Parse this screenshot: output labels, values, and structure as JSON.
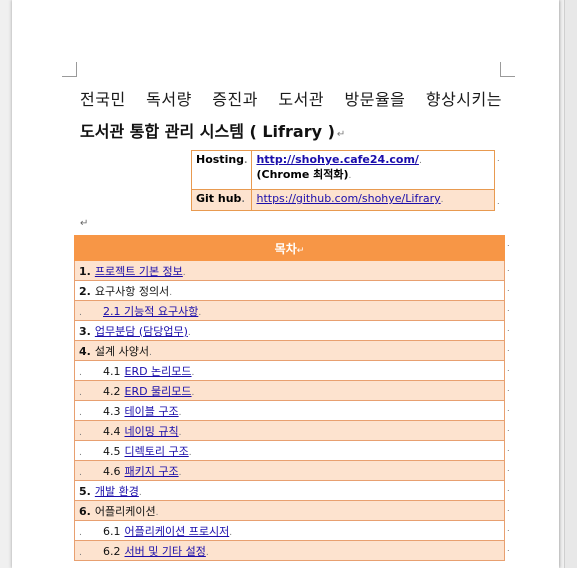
{
  "title": {
    "line1_words": [
      "전국민",
      "독서량",
      "증진과",
      "도서관",
      "방문율을",
      "향상시키는"
    ],
    "line2": "도서관 통합 관리 시스템 ( Lifrary )"
  },
  "info": [
    {
      "label": "Hosting",
      "link": "http://shohye.cafe24.com/",
      "note": "(Chrome 최적화)"
    },
    {
      "label": "Git hub",
      "link": "https://github.com/shohye/Lifrary"
    }
  ],
  "toc": {
    "heading": "목차",
    "items": [
      {
        "indent": 0,
        "num": "1.",
        "text": "프로젝트 기본 정보",
        "link": true,
        "shade": true
      },
      {
        "indent": 0,
        "num": "2.",
        "text": "요구사항 정의서",
        "link": false,
        "shade": false
      },
      {
        "indent": 1,
        "num": "",
        "text": "2.1 기능적 요구사항",
        "link": true,
        "shade": true
      },
      {
        "indent": 0,
        "num": "3.",
        "text": "업무분담 (담당업무)",
        "link": true,
        "shade": false
      },
      {
        "indent": 0,
        "num": "4.",
        "text": "설계 사양서",
        "link": false,
        "shade": true
      },
      {
        "indent": 1,
        "num": "4.1",
        "text": "ERD 논리모드",
        "link": true,
        "shade": false
      },
      {
        "indent": 1,
        "num": "4.2",
        "text": "ERD 물리모드",
        "link": true,
        "shade": true
      },
      {
        "indent": 1,
        "num": "4.3",
        "text": "테이블 구조",
        "link": true,
        "shade": false
      },
      {
        "indent": 1,
        "num": "4.4",
        "text": "네이밍 규칙",
        "link": true,
        "shade": true
      },
      {
        "indent": 1,
        "num": "4.5",
        "text": "디렉토리 구조",
        "link": true,
        "shade": false
      },
      {
        "indent": 1,
        "num": "4.6",
        "text": "패키지 구조",
        "link": true,
        "shade": true
      },
      {
        "indent": 0,
        "num": "5.",
        "text": "개발 환경",
        "link": true,
        "shade": false
      },
      {
        "indent": 0,
        "num": "6.",
        "text": "어플리케이션",
        "link": false,
        "shade": true
      },
      {
        "indent": 1,
        "num": "6.1",
        "text": "어플리케이션 프로시저",
        "link": true,
        "shade": false
      },
      {
        "indent": 1,
        "num": "6.2",
        "text": "서버 및 기타 설정",
        "link": true,
        "shade": true
      }
    ]
  }
}
